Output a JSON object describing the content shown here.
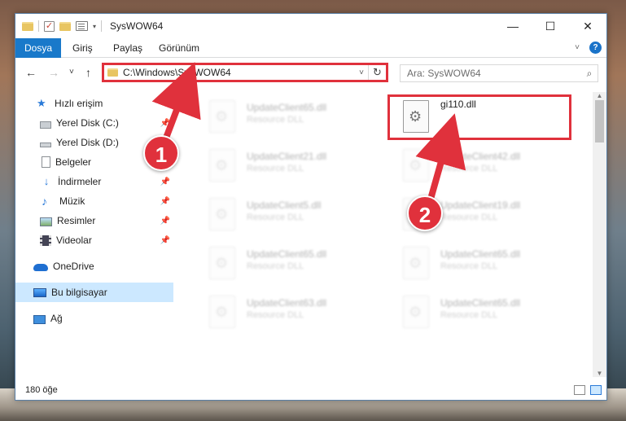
{
  "window": {
    "title": "SysWOW64",
    "controls": {
      "minimize": "—",
      "maximize": "☐",
      "close": "✕"
    }
  },
  "ribbon": {
    "tabs": [
      "Dosya",
      "Giriş",
      "Paylaş",
      "Görünüm"
    ]
  },
  "navigation": {
    "back": "←",
    "forward": "→",
    "recent": "˅",
    "up": "↑",
    "address_path": "C:\\Windows\\SysWOW64",
    "refresh": "↻",
    "search_placeholder": "Ara: SysWOW64",
    "search_icon": "⌕"
  },
  "sidebar": {
    "items": [
      {
        "label": "Hızlı erişim",
        "icon": "star-icon"
      },
      {
        "label": "Yerel Disk (C:)",
        "icon": "drive-icon",
        "pinned": true
      },
      {
        "label": "Yerel Disk (D:)",
        "icon": "drive-icon",
        "pinned": true
      },
      {
        "label": "Belgeler",
        "icon": "document-icon",
        "pinned": true
      },
      {
        "label": "İndirmeler",
        "icon": "download-icon",
        "pinned": true
      },
      {
        "label": "Müzik",
        "icon": "music-icon",
        "pinned": true
      },
      {
        "label": "Resimler",
        "icon": "pictures-icon",
        "pinned": true
      },
      {
        "label": "Videolar",
        "icon": "video-icon",
        "pinned": true
      },
      {
        "label": "OneDrive",
        "icon": "cloud-icon"
      },
      {
        "label": "Bu bilgisayar",
        "icon": "computer-icon",
        "selected": true
      },
      {
        "label": "Ağ",
        "icon": "network-icon"
      }
    ]
  },
  "files": {
    "left_column": [
      {
        "name": "UpdateClient65.dll",
        "type": "Resource DLL"
      },
      {
        "name": "UpdateClient21.dll",
        "type": "Resource DLL"
      },
      {
        "name": "UpdateClient5.dll",
        "type": "Resource DLL"
      },
      {
        "name": "UpdateClient65.dll",
        "type": "Resource DLL"
      },
      {
        "name": "UpdateClient63.dll",
        "type": "Resource DLL"
      }
    ],
    "right_column": [
      {
        "name": "gi110.dll",
        "type": ""
      },
      {
        "name": "UpdateClient42.dll",
        "type": "Resource DLL"
      },
      {
        "name": "UpdateClient19.dll",
        "type": "Resource DLL"
      },
      {
        "name": "UpdateClient65.dll",
        "type": "Resource DLL"
      },
      {
        "name": "UpdateClient65.dll",
        "type": "Resource DLL"
      }
    ]
  },
  "status": {
    "item_count": "180 öğe"
  },
  "annotations": {
    "step1": "1",
    "step2": "2",
    "accent_color": "#e0313c"
  }
}
